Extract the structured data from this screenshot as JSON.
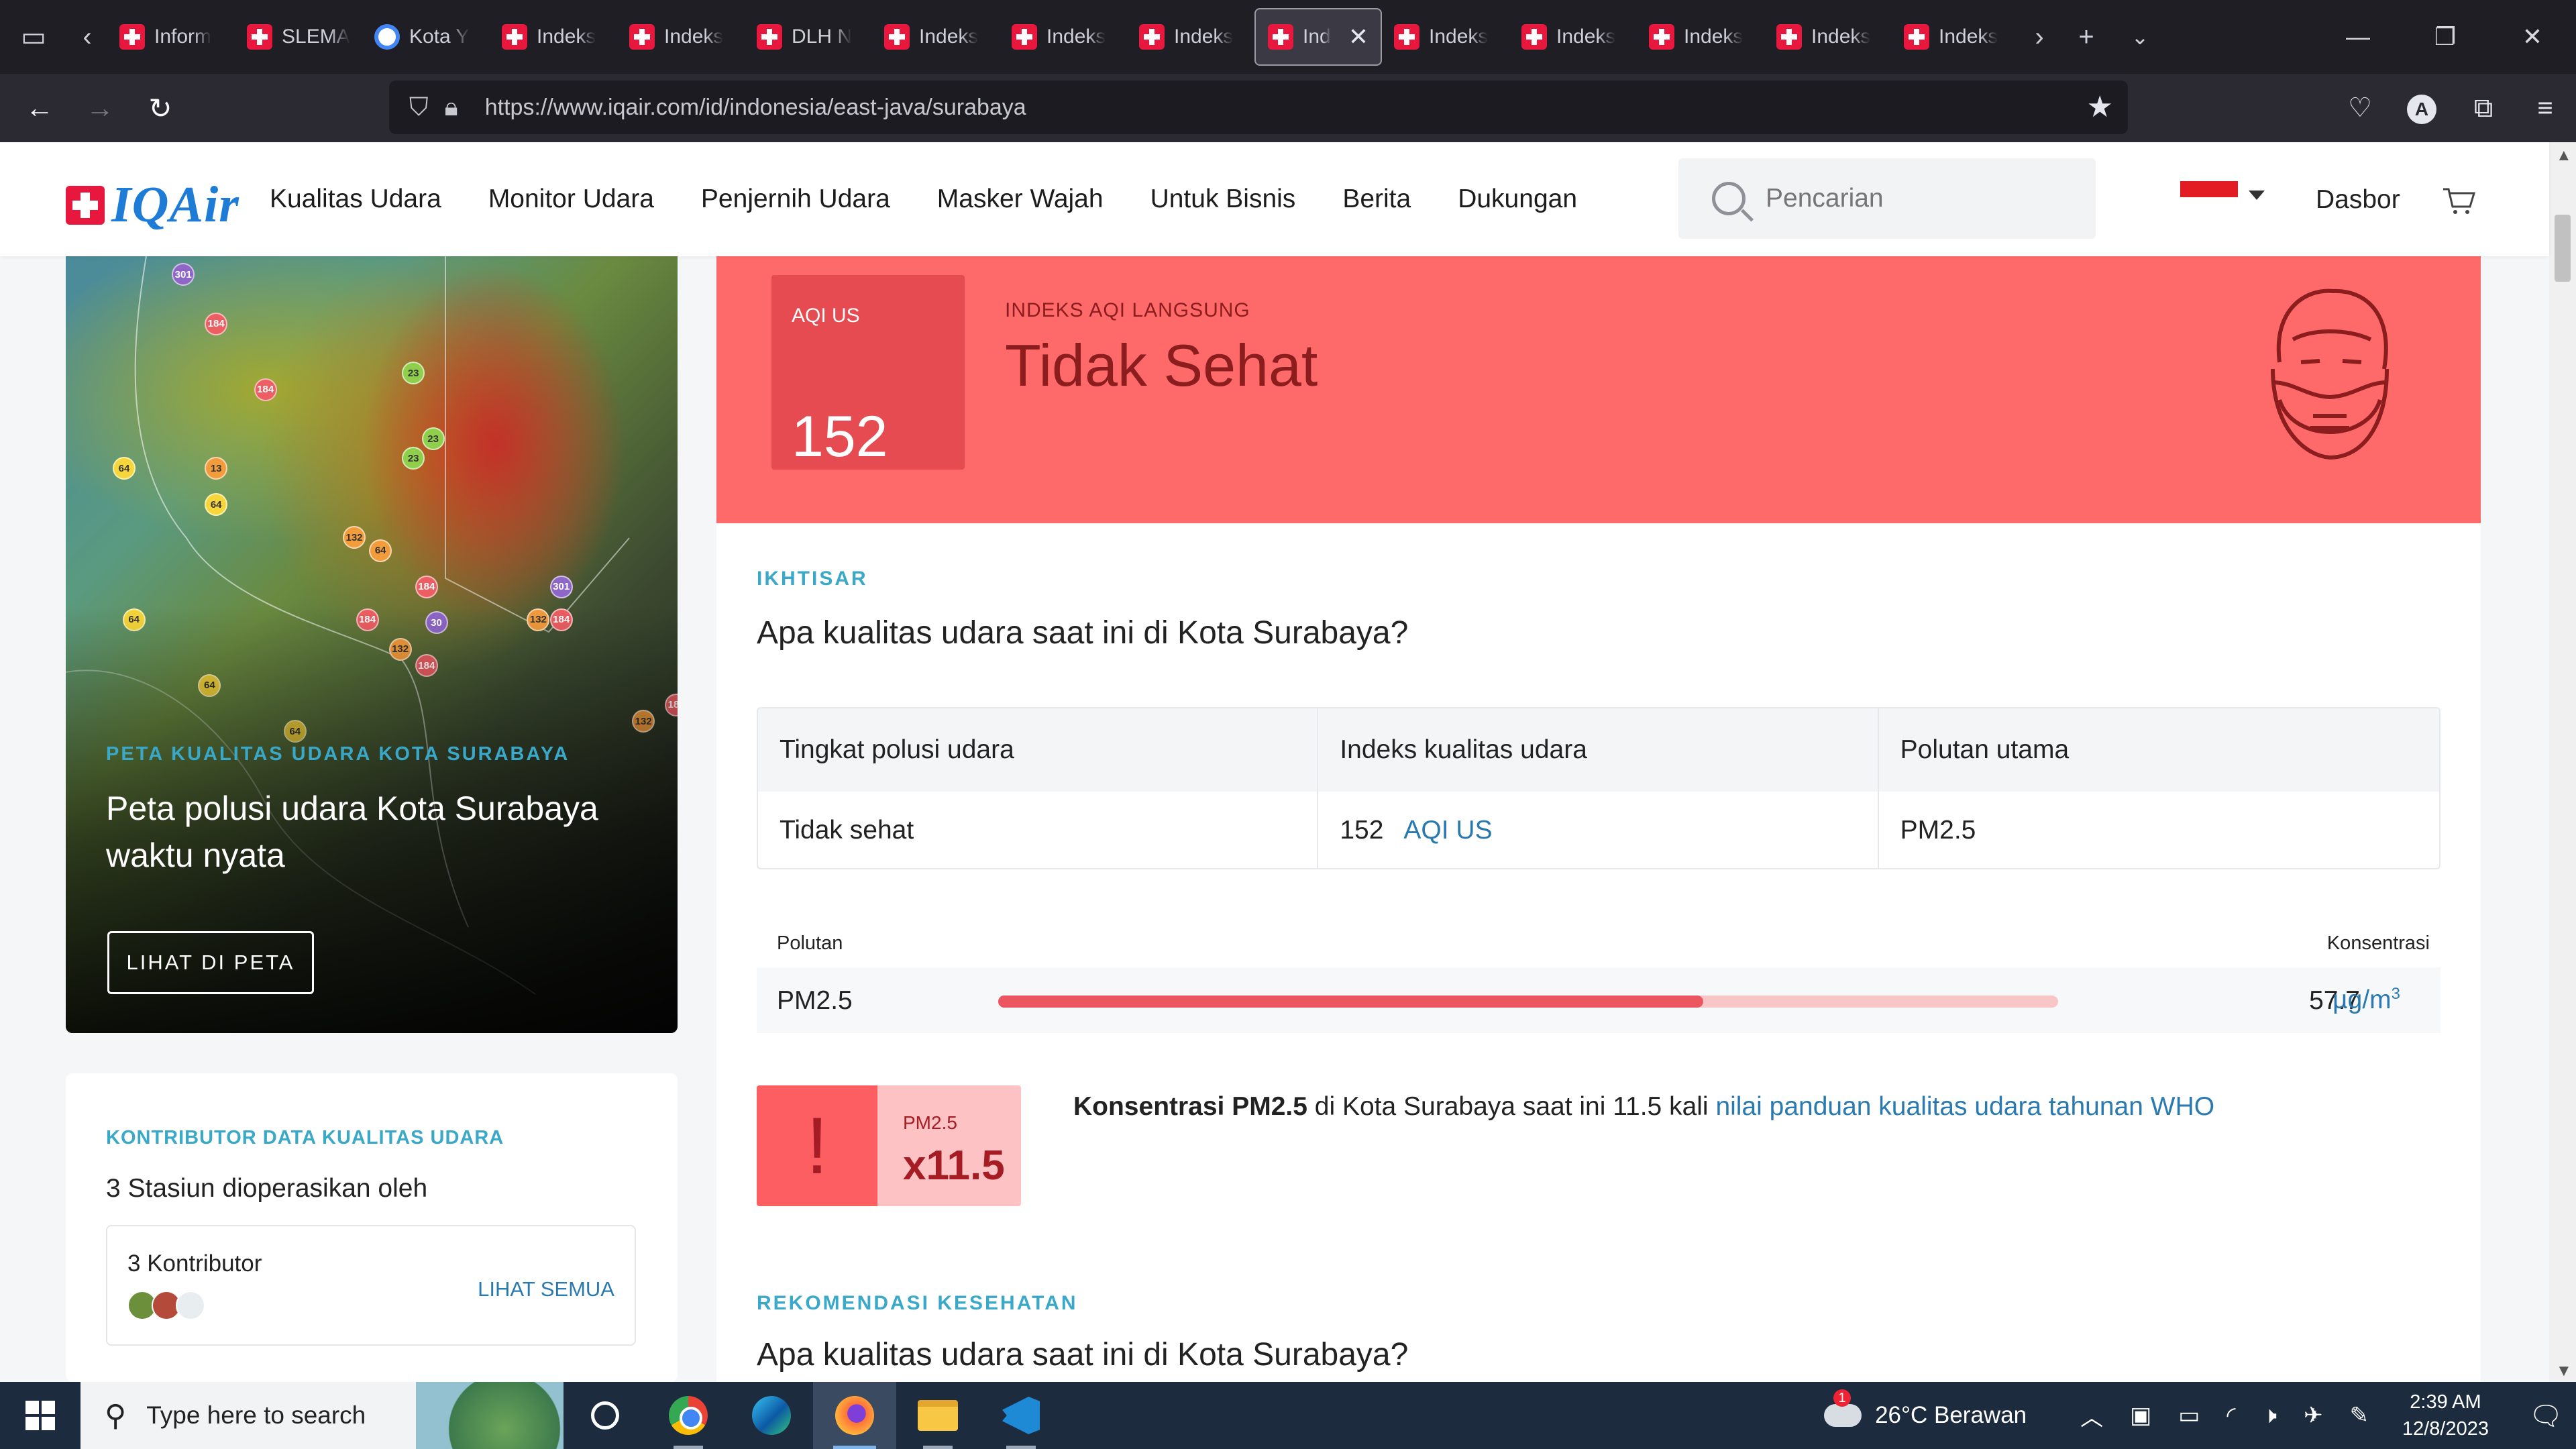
{
  "browser": {
    "tabs": [
      {
        "title": "Inform",
        "icon": "iqair-favicon"
      },
      {
        "title": "SLEMA",
        "icon": "iqair-favicon"
      },
      {
        "title": "Kota Y",
        "icon": "google-favicon"
      },
      {
        "title": "Indeks",
        "icon": "iqair-favicon"
      },
      {
        "title": "Indeks",
        "icon": "iqair-favicon"
      },
      {
        "title": "DLH N",
        "icon": "iqair-favicon"
      },
      {
        "title": "Indeks",
        "icon": "iqair-favicon"
      },
      {
        "title": "Indeks",
        "icon": "iqair-favicon"
      },
      {
        "title": "Indeks",
        "icon": "iqair-favicon"
      },
      {
        "title": "Ind",
        "icon": "iqair-favicon",
        "active": true
      },
      {
        "title": "Indeks",
        "icon": "iqair-favicon"
      },
      {
        "title": "Indeks",
        "icon": "iqair-favicon"
      },
      {
        "title": "Indeks",
        "icon": "iqair-favicon"
      },
      {
        "title": "Indeks",
        "icon": "iqair-favicon"
      },
      {
        "title": "Indeks",
        "icon": "iqair-favicon"
      }
    ],
    "url": "https://www.iqair.com/id/indonesia/east-java/surabaya"
  },
  "site": {
    "logo_text": "IQAir",
    "menu": [
      "Kualitas Udara",
      "Monitor Udara",
      "Penjernih Udara",
      "Masker Wajah",
      "Untuk Bisnis",
      "Berita",
      "Dukungan"
    ],
    "search_placeholder": "Pencarian",
    "dashboard": "Dasbor"
  },
  "map_card": {
    "markers": [
      "301",
      "184",
      "184",
      "64",
      "13",
      "64",
      "64",
      "64",
      "132",
      "23",
      "23",
      "23",
      "64",
      "184",
      "132",
      "30",
      "184",
      "184",
      "132",
      "301",
      "64",
      "184",
      "64",
      "132",
      "184",
      "64",
      "23",
      "23",
      "23"
    ],
    "kicker": "PETA KUALITAS UDARA KOTA SURABAYA",
    "title": "Peta polusi udara Kota Surabaya waktu nyata",
    "button": "LIHAT DI PETA"
  },
  "contributors": {
    "kicker": "KONTRIBUTOR DATA KUALITAS UDARA",
    "subtitle": "3 Stasiun dioperasikan oleh",
    "count": "3 Kontributor",
    "view_all": "LIHAT SEMUA"
  },
  "aqi": {
    "label": "AQI US",
    "value": "152",
    "live_label": "INDEKS AQI LANGSUNG",
    "status": "Tidak Sehat",
    "banner_color": "#fe6a69",
    "box_color": "#e64b51"
  },
  "overview": {
    "kicker": "IKHTISAR",
    "question": "Apa kualitas udara saat ini di Kota Surabaya?",
    "headers": [
      "Tingkat polusi udara",
      "Indeks kualitas udara",
      "Polutan utama"
    ],
    "row": {
      "level": "Tidak sehat",
      "aqi_value": "152",
      "aqi_unit": "AQI US",
      "main_pollutant": "PM2.5"
    }
  },
  "pollutants": {
    "col_pollutant": "Polutan",
    "col_concentration": "Konsentrasi",
    "items": [
      {
        "name": "PM2.5",
        "value": "57.7",
        "unit": "µg/m",
        "unit_exp": "3",
        "fill_fraction": 0.665
      }
    ]
  },
  "who": {
    "exclaim": "!",
    "pollutant": "PM2.5",
    "multiplier": "x11.5",
    "text_bold": "Konsentrasi PM2.5",
    "text_mid": " di Kota Surabaya saat ini 11.5 kali ",
    "text_link": "nilai panduan kualitas udara tahunan WHO"
  },
  "health": {
    "kicker": "REKOMENDASI KESEHATAN",
    "question": "Apa kualitas udara saat ini di Kota Surabaya?"
  },
  "taskbar": {
    "search_placeholder": "Type here to search",
    "weather": "26°C  Berawan",
    "weather_badge": "1",
    "time": "2:39 AM",
    "date": "12/8/2023"
  }
}
